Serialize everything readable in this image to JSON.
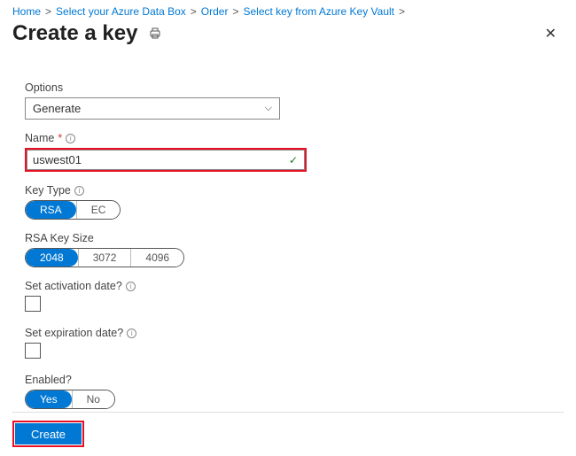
{
  "breadcrumb": {
    "home": "Home",
    "databox": "Select your Azure Data Box",
    "order": "Order",
    "keyvault": "Select key from Azure Key Vault"
  },
  "title": "Create a key",
  "options": {
    "label": "Options",
    "value": "Generate"
  },
  "name": {
    "label": "Name",
    "value": "uswest01"
  },
  "keyType": {
    "label": "Key Type",
    "opts": {
      "rsa": "RSA",
      "ec": "EC"
    }
  },
  "rsaSize": {
    "label": "RSA Key Size",
    "opts": {
      "s2048": "2048",
      "s3072": "3072",
      "s4096": "4096"
    }
  },
  "activation": {
    "label": "Set activation date?"
  },
  "expiration": {
    "label": "Set expiration date?"
  },
  "enabled": {
    "label": "Enabled?",
    "opts": {
      "yes": "Yes",
      "no": "No"
    }
  },
  "buttons": {
    "create": "Create"
  }
}
